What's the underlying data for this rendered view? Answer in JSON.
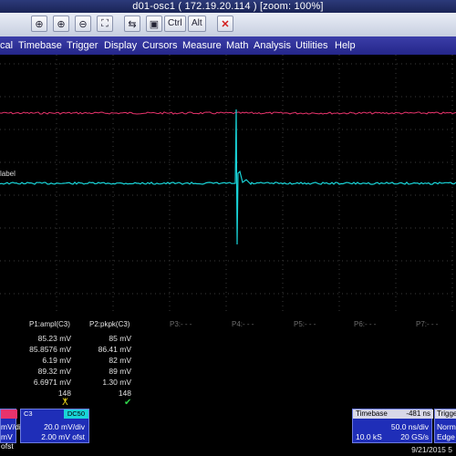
{
  "window": {
    "title": "d01-osc1 ( 172.19.20.114 ) [zoom: 100%]"
  },
  "toolbar": {
    "ctrl_label": "Ctrl",
    "alt_label": "Alt"
  },
  "menu": {
    "items": [
      "cal",
      "Timebase",
      "Trigger",
      "Display",
      "Cursors",
      "Measure",
      "Math",
      "Analysis",
      "Utilities",
      "Help"
    ]
  },
  "trace": {
    "label": "label",
    "colors": {
      "magenta": "#e8336c",
      "cyan": "#19d4d8"
    }
  },
  "measurements": {
    "headers": [
      "P1:ampl(C3)",
      "P2:pkpk(C3)",
      "P3:- - -",
      "P4:- - -",
      "P5:- - -",
      "P6:- - -",
      "P7:- - -"
    ],
    "rows": [
      [
        "85.23 mV",
        "85 mV"
      ],
      [
        "85.8576 mV",
        "86.41 mV"
      ],
      [
        "6.19 mV",
        "82 mV"
      ],
      [
        "89.32 mV",
        "89 mV"
      ],
      [
        "6.6971 mV",
        "1.30 mV"
      ],
      [
        "148",
        "148"
      ]
    ],
    "status": [
      "x-icon",
      "check-icon"
    ]
  },
  "channels": {
    "left": {
      "scale": "mV/div",
      "offset": "mV ofst"
    },
    "c3": {
      "name": "C3",
      "coupling": "DC50",
      "scale": "20.0 mV/div",
      "offset": "2.00 mV ofst"
    }
  },
  "timebase": {
    "header": "Timebase",
    "delay": "-481 ns",
    "scale": "50.0 ns/div",
    "samples": "10.0 kS",
    "rate": "20 GS/s"
  },
  "trigger": {
    "header": "Trigge",
    "mode": "Norm",
    "type": "Edge"
  },
  "timestamp": "9/21/2015 5"
}
